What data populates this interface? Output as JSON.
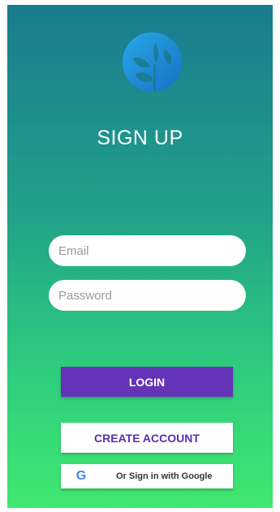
{
  "screen": {
    "title": "SIGN UP"
  },
  "form": {
    "email_placeholder": "Email",
    "email_value": "",
    "password_placeholder": "Password",
    "password_value": ""
  },
  "buttons": {
    "login_label": "LOGIN",
    "create_account_label": "CREATE ACCOUNT",
    "google_label": "Or Sign in with Google",
    "google_icon_glyph": "G"
  },
  "icons": {
    "logo": "leaf-logo-icon",
    "google": "google-g-icon"
  },
  "colors": {
    "gradient_top": "#1a7b8f",
    "gradient_bottom": "#3fe86f",
    "login_button": "#6533b8",
    "create_account_text": "#5a2fb0",
    "logo_blue": "#1e90d6"
  }
}
